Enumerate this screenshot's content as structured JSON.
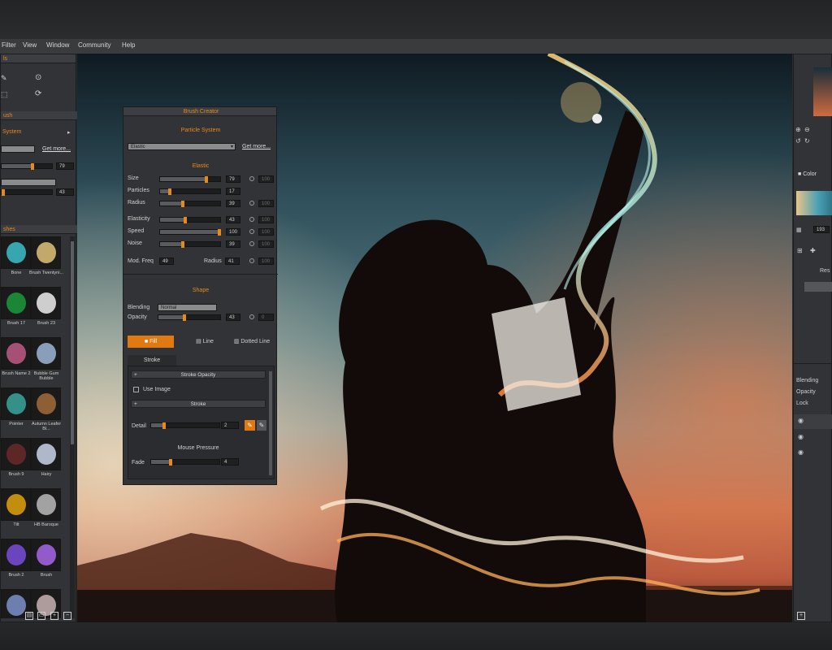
{
  "menu": [
    "Filter",
    "View",
    "Window",
    "Community",
    "Help"
  ],
  "left_panels": {
    "tools_header": "ls",
    "brush_header": "ush",
    "particle_label": "System",
    "get_more": "Get more...",
    "val1": "79",
    "val2": "43",
    "brushes_header": "shes",
    "thumbs": [
      {
        "label": "Bone"
      },
      {
        "label": "Brush Twentyni..."
      },
      {
        "label": "Brush 17"
      },
      {
        "label": "Brush 23"
      },
      {
        "label": "Brush Name 2"
      },
      {
        "label": "Bubble Gum Bubble"
      },
      {
        "label": "Pointer"
      },
      {
        "label": "Autumn Leafer Bl..."
      },
      {
        "label": "Brush 9"
      },
      {
        "label": "Hairy"
      },
      {
        "label": "Tilt"
      },
      {
        "label": "HB Baroque"
      },
      {
        "label": "Brush 2"
      },
      {
        "label": "Brush"
      },
      {
        "label": ""
      },
      {
        "label": ""
      }
    ]
  },
  "brush_creator": {
    "title": "Brush Creator",
    "section": "Particle System",
    "preset": "Elastic",
    "get_more": "Get more...",
    "elastic_title": "Elastic",
    "params": [
      {
        "label": "Size",
        "value": "79",
        "ghost": "100",
        "fill": 0.79
      },
      {
        "label": "Particles",
        "value": "17",
        "ghost": "",
        "fill": 0.17
      },
      {
        "label": "Radius",
        "value": "39",
        "ghost": "100",
        "fill": 0.39
      },
      {
        "label": "Elasticity",
        "value": "43",
        "ghost": "100",
        "fill": 0.43
      },
      {
        "label": "Speed",
        "value": "100",
        "ghost": "100",
        "fill": 1.0
      },
      {
        "label": "Noise",
        "value": "39",
        "ghost": "100",
        "fill": 0.39
      }
    ],
    "mod_freq_label": "Mod. Freq",
    "mod_freq_value": "49",
    "radius2_label": "Radius",
    "radius2_value": "41",
    "radius2_ghost": "100",
    "shape_title": "Shape",
    "blending_label": "Blending",
    "blending_value": "Normal",
    "opacity_label": "Opacity",
    "opacity_value": "43",
    "opacity_ghost": "0",
    "opacity_fill": 0.43,
    "tab_fill": "Fill",
    "tab_line": "Line",
    "tab_dotted": "Dotted Line",
    "stroke_label": "Stroke",
    "stroke_opacity": "Stroke Opacity",
    "use_image": "Use Image",
    "stroke_bar": "Stroke",
    "detail_label": "Detail",
    "detail_value": "2",
    "detail_fill": 0.2,
    "mouse_pressure": "Mouse Pressure",
    "fade_label": "Fade",
    "fade_value": "4",
    "fade_fill": 0.3
  },
  "right_panels": {
    "color_tab": "Color",
    "num_193": "193",
    "res_label": "Res",
    "blending_label": "Blending",
    "opacity_label": "Opacity",
    "lock_label": "Lock"
  },
  "colors": {
    "accent": "#e68a1e",
    "panel": "#323336",
    "panel_dark": "#1c1d1f"
  }
}
